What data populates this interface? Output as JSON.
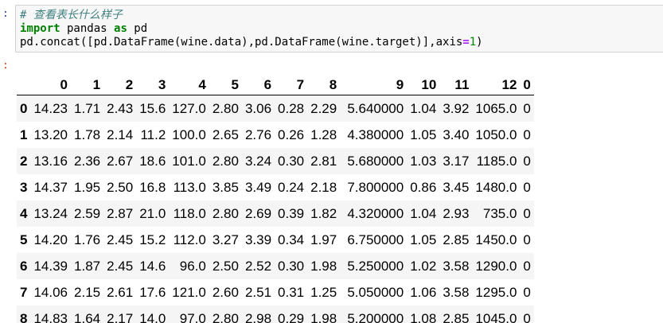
{
  "input_prompt": ":",
  "output_prompt": ":",
  "code": {
    "comment": "# 查看表长什么样子",
    "line2_kw": "import",
    "line2_mod": " pandas ",
    "line2_as": "as",
    "line2_alias": " pd",
    "line3_a": "pd.concat([pd.DataFrame(wine.data),pd.DataFrame(wine.target)],axis",
    "line3_eq": "=",
    "line3_num": "1",
    "line3_end": ")"
  },
  "table": {
    "columns": [
      "",
      "0",
      "1",
      "2",
      "3",
      "4",
      "5",
      "6",
      "7",
      "8",
      "9",
      "10",
      "11",
      "12",
      "0"
    ],
    "rows": [
      [
        "0",
        "14.23",
        "1.71",
        "2.43",
        "15.6",
        "127.0",
        "2.80",
        "3.06",
        "0.28",
        "2.29",
        "5.640000",
        "1.04",
        "3.92",
        "1065.0",
        "0"
      ],
      [
        "1",
        "13.20",
        "1.78",
        "2.14",
        "11.2",
        "100.0",
        "2.65",
        "2.76",
        "0.26",
        "1.28",
        "4.380000",
        "1.05",
        "3.40",
        "1050.0",
        "0"
      ],
      [
        "2",
        "13.16",
        "2.36",
        "2.67",
        "18.6",
        "101.0",
        "2.80",
        "3.24",
        "0.30",
        "2.81",
        "5.680000",
        "1.03",
        "3.17",
        "1185.0",
        "0"
      ],
      [
        "3",
        "14.37",
        "1.95",
        "2.50",
        "16.8",
        "113.0",
        "3.85",
        "3.49",
        "0.24",
        "2.18",
        "7.800000",
        "0.86",
        "3.45",
        "1480.0",
        "0"
      ],
      [
        "4",
        "13.24",
        "2.59",
        "2.87",
        "21.0",
        "118.0",
        "2.80",
        "2.69",
        "0.39",
        "1.82",
        "4.320000",
        "1.04",
        "2.93",
        "735.0",
        "0"
      ],
      [
        "5",
        "14.20",
        "1.76",
        "2.45",
        "15.2",
        "112.0",
        "3.27",
        "3.39",
        "0.34",
        "1.97",
        "6.750000",
        "1.05",
        "2.85",
        "1450.0",
        "0"
      ],
      [
        "6",
        "14.39",
        "1.87",
        "2.45",
        "14.6",
        "96.0",
        "2.50",
        "2.52",
        "0.30",
        "1.98",
        "5.250000",
        "1.02",
        "3.58",
        "1290.0",
        "0"
      ],
      [
        "7",
        "14.06",
        "2.15",
        "2.61",
        "17.6",
        "121.0",
        "2.60",
        "2.51",
        "0.31",
        "1.25",
        "5.050000",
        "1.06",
        "3.58",
        "1295.0",
        "0"
      ],
      [
        "8",
        "14.83",
        "1.64",
        "2.17",
        "14.0",
        "97.0",
        "2.80",
        "2.98",
        "0.29",
        "1.98",
        "5.200000",
        "1.08",
        "2.85",
        "1045.0",
        "0"
      ]
    ]
  }
}
